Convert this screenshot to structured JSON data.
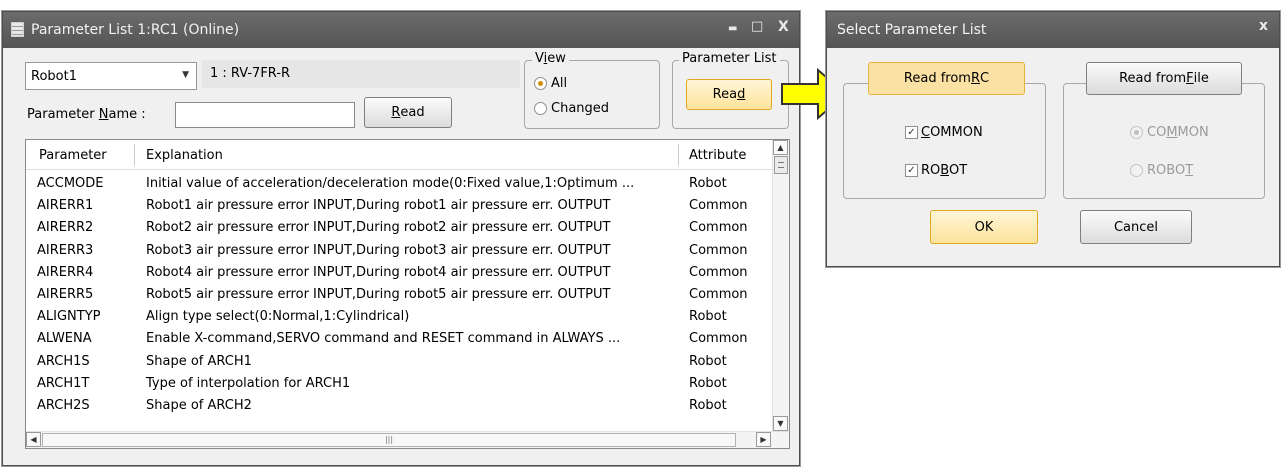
{
  "param_window": {
    "title": "Parameter List 1:RC1 (Online)",
    "minimize": "▬",
    "maximize": "□",
    "close": "X",
    "robot_select": "Robot1",
    "robot_model": "1 : RV-7FR-R",
    "param_name_label_pre": "Parameter ",
    "param_name_label_u": "N",
    "param_name_label_post": "ame :",
    "param_name_value": "",
    "read_button_pre": "",
    "read_button_u": "R",
    "read_button_post": "ead",
    "view_group": {
      "label_pre": "V",
      "label_u": "i",
      "label_post": "ew",
      "options": [
        "All",
        "Changed"
      ],
      "selected": "All"
    },
    "param_list_group": {
      "label": "Parameter List",
      "button_pre": "Rea",
      "button_u": "d",
      "button_post": ""
    },
    "table": {
      "headers": [
        "Parameter",
        "Explanation",
        "Attribute"
      ],
      "rows": [
        [
          "ACCMODE",
          "Initial value of acceleration/deceleration mode(0:Fixed value,1:Optimum ...",
          "Robot"
        ],
        [
          "AIRERR1",
          "Robot1 air pressure error INPUT,During robot1 air pressure err. OUTPUT",
          "Common"
        ],
        [
          "AIRERR2",
          "Robot2 air pressure error INPUT,During robot2 air pressure err. OUTPUT",
          "Common"
        ],
        [
          "AIRERR3",
          "Robot3 air pressure error INPUT,During robot3 air pressure err. OUTPUT",
          "Common"
        ],
        [
          "AIRERR4",
          "Robot4 air pressure error INPUT,During robot4 air pressure err. OUTPUT",
          "Common"
        ],
        [
          "AIRERR5",
          "Robot5 air pressure error INPUT,During robot5 air pressure err. OUTPUT",
          "Common"
        ],
        [
          "ALIGNTYP",
          "Align type select(0:Normal,1:Cylindrical)",
          "Robot"
        ],
        [
          "ALWENA",
          "Enable X-command,SERVO command and RESET command in ALWAYS ...",
          "Common"
        ],
        [
          "ARCH1S",
          "Shape of ARCH1",
          "Robot"
        ],
        [
          "ARCH1T",
          "Type of interpolation for ARCH1",
          "Robot"
        ],
        [
          "ARCH2S",
          "Shape of ARCH2",
          "Robot"
        ]
      ]
    },
    "hscroll_grip": "|||"
  },
  "select_dialog": {
    "title": "Select Parameter List",
    "close": "x",
    "rc_button_pre": "Read from ",
    "rc_button_u": "R",
    "rc_button_post": "C",
    "file_button_pre": "Read from ",
    "file_button_u": "F",
    "file_button_post": "ile",
    "rc_checks": [
      {
        "pre": "",
        "u": "C",
        "post": "OMMON",
        "checked": true
      },
      {
        "pre": "RO",
        "u": "B",
        "post": "OT",
        "checked": true
      }
    ],
    "file_radios": [
      {
        "pre": "CO",
        "u": "M",
        "post": "MON",
        "selected": true
      },
      {
        "pre": "ROBO",
        "u": "T",
        "post": "",
        "selected": false
      }
    ],
    "ok": "OK",
    "cancel": "Cancel"
  },
  "colors": {
    "titlebar": "#5f5f5f",
    "highlight": "#fbe2a4",
    "arrow_fill": "#ffff00"
  }
}
